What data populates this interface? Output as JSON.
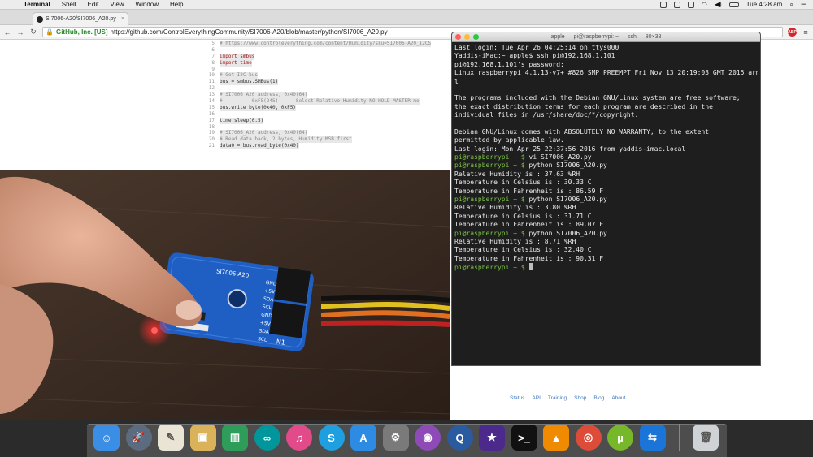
{
  "menubar": {
    "app_name": "Terminal",
    "menus": [
      "Shell",
      "Edit",
      "View",
      "Window",
      "Help"
    ],
    "clock": "Tue 4:28 am"
  },
  "browser": {
    "tab_title": "SI7006-A20/SI7006_A20.py",
    "ev_label": "GitHub, Inc. [US]",
    "url": "https://github.com/ControlEverythingCommunity/SI7006-A20/blob/master/python/SI7006_A20.py",
    "abp_label": "ABP"
  },
  "code_lines": [
    {
      "n": "5",
      "t": "# https://www.controleverything.com/content/Humidity?sku=SI7006-A20_I2CS",
      "c": "cm"
    },
    {
      "n": "6",
      "t": "",
      "c": ""
    },
    {
      "n": "7",
      "t": "import smbus",
      "c": "kw"
    },
    {
      "n": "8",
      "t": "import time",
      "c": "kw"
    },
    {
      "n": "9",
      "t": "",
      "c": ""
    },
    {
      "n": "10",
      "t": "# Get I2C bus",
      "c": "cm"
    },
    {
      "n": "11",
      "t": "bus = smbus.SMBus(1)",
      "c": ""
    },
    {
      "n": "12",
      "t": "",
      "c": ""
    },
    {
      "n": "13",
      "t": "# SI7006_A20 address, 0x40(64)",
      "c": "cm"
    },
    {
      "n": "14",
      "t": "#          0xF5(245)      Select Relative Humidity NO HOLD MASTER mo",
      "c": "cm"
    },
    {
      "n": "15",
      "t": "bus.write_byte(0x40, 0xF5)",
      "c": ""
    },
    {
      "n": "16",
      "t": "",
      "c": ""
    },
    {
      "n": "17",
      "t": "time.sleep(0.5)",
      "c": ""
    },
    {
      "n": "18",
      "t": "",
      "c": ""
    },
    {
      "n": "19",
      "t": "# SI7006_A20 address, 0x40(64)",
      "c": "cm"
    },
    {
      "n": "20",
      "t": "# Read data back, 2 bytes, Humidity MSB first",
      "c": "cm"
    },
    {
      "n": "21",
      "t": "data0 = bus.read_byte(0x40)",
      "c": ""
    }
  ],
  "footer_links": [
    "Status",
    "API",
    "Training",
    "Shop",
    "Blog",
    "About"
  ],
  "terminal": {
    "title": "apple — pi@raspberrypi: ~ — ssh — 80×38",
    "lines": [
      {
        "p": "",
        "t": "Last login: Tue Apr 26 04:25:14 on ttys000"
      },
      {
        "p": "",
        "t": "Yaddis-iMac:~ apple$ ssh pi@192.168.1.101"
      },
      {
        "p": "",
        "t": "pi@192.168.1.101's password:"
      },
      {
        "p": "",
        "t": "Linux raspberrypi 4.1.13-v7+ #826 SMP PREEMPT Fri Nov 13 20:19:03 GMT 2015 armv7"
      },
      {
        "p": "",
        "t": "l"
      },
      {
        "p": "",
        "t": ""
      },
      {
        "p": "",
        "t": "The programs included with the Debian GNU/Linux system are free software;"
      },
      {
        "p": "",
        "t": "the exact distribution terms for each program are described in the"
      },
      {
        "p": "",
        "t": "individual files in /usr/share/doc/*/copyright."
      },
      {
        "p": "",
        "t": ""
      },
      {
        "p": "",
        "t": "Debian GNU/Linux comes with ABSOLUTELY NO WARRANTY, to the extent"
      },
      {
        "p": "",
        "t": "permitted by applicable law."
      },
      {
        "p": "",
        "t": "Last login: Mon Apr 25 22:37:56 2016 from yaddis-imac.local"
      },
      {
        "p": "pi@raspberrypi ~ $",
        "t": " vi SI7006_A20.py"
      },
      {
        "p": "pi@raspberrypi ~ $",
        "t": " python SI7006_A20.py"
      },
      {
        "p": "",
        "t": "Relative Humidity is : 37.63 %RH"
      },
      {
        "p": "",
        "t": "Temperature in Celsius is : 30.33 C"
      },
      {
        "p": "",
        "t": "Temperature in Fahrenheit is : 86.59 F"
      },
      {
        "p": "pi@raspberrypi ~ $",
        "t": " python SI7006_A20.py"
      },
      {
        "p": "",
        "t": "Relative Humidity is : 3.80 %RH"
      },
      {
        "p": "",
        "t": "Temperature in Celsius is : 31.71 C"
      },
      {
        "p": "",
        "t": "Temperature in Fahrenheit is : 89.07 F"
      },
      {
        "p": "pi@raspberrypi ~ $",
        "t": " python SI7006_A20.py"
      },
      {
        "p": "",
        "t": "Relative Humidity is : 8.71 %RH"
      },
      {
        "p": "",
        "t": "Temperature in Celsius is : 32.40 C"
      },
      {
        "p": "",
        "t": "Temperature in Fahrenheit is : 90.31 F"
      },
      {
        "p": "pi@raspberrypi ~ $",
        "t": " ",
        "cursor": true
      }
    ]
  },
  "board": {
    "model": "SI7006-A20",
    "pins": [
      "GND",
      "+5V",
      "SDA",
      "SCL",
      "GND",
      "+5V",
      "SDA",
      "SCL"
    ],
    "marking": "N1"
  },
  "dock": [
    {
      "name": "finder",
      "color": "#3a8ee6",
      "glyph": "☺"
    },
    {
      "name": "launchpad",
      "color": "#5b6b80",
      "glyph": "🚀"
    },
    {
      "name": "textedit",
      "color": "#e9e4d4",
      "glyph": "✎"
    },
    {
      "name": "preview",
      "color": "#d9b25a",
      "glyph": "▣"
    },
    {
      "name": "numbers",
      "color": "#2f9d5a",
      "glyph": "▥"
    },
    {
      "name": "arduino",
      "color": "#00979c",
      "glyph": "∞"
    },
    {
      "name": "itunes",
      "color": "#e24a8a",
      "glyph": "♫"
    },
    {
      "name": "skype",
      "color": "#1ea0e0",
      "glyph": "S"
    },
    {
      "name": "app-store",
      "color": "#2d8be3",
      "glyph": "A"
    },
    {
      "name": "system-preferences",
      "color": "#7a7a7a",
      "glyph": "⚙"
    },
    {
      "name": "github-desktop",
      "color": "#8e4bb8",
      "glyph": "◉"
    },
    {
      "name": "quicktime",
      "color": "#2a5aa0",
      "glyph": "Q"
    },
    {
      "name": "imovie",
      "color": "#4b2a8c",
      "glyph": "★"
    },
    {
      "name": "terminal",
      "color": "#111111",
      "glyph": ">_"
    },
    {
      "name": "vlc",
      "color": "#f08a00",
      "glyph": "▲"
    },
    {
      "name": "chrome",
      "color": "#dd4b39",
      "glyph": "◎"
    },
    {
      "name": "utorrent",
      "color": "#77b82a",
      "glyph": "µ"
    },
    {
      "name": "teamviewer",
      "color": "#1b74d8",
      "glyph": "⇆"
    },
    {
      "name": "trash",
      "color": "#cfd3d6",
      "glyph": "🗑"
    }
  ]
}
